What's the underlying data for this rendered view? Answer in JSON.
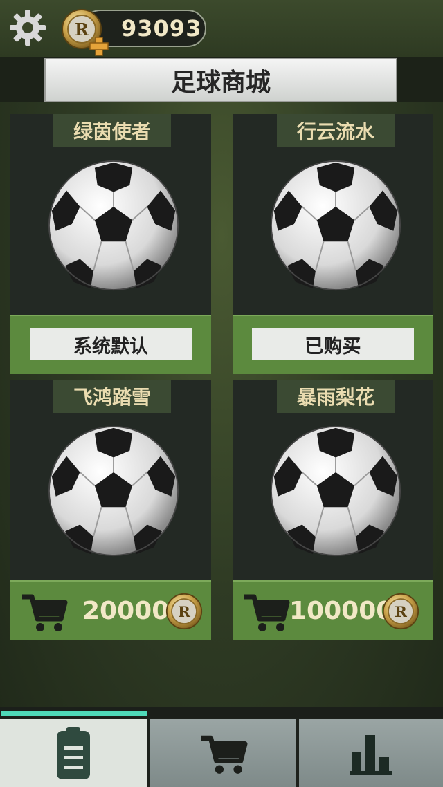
{
  "header": {
    "balance": "93093",
    "currency_symbol": "R"
  },
  "title": "足球商城",
  "cards": [
    {
      "name": "绿茵使者",
      "status": "系统默认"
    },
    {
      "name": "行云流水",
      "status": "已购买"
    },
    {
      "name": "飞鸿踏雪",
      "price": "20000"
    },
    {
      "name": "暴雨梨花",
      "price": "100000"
    }
  ],
  "progress": 0.33,
  "tabs": [
    {
      "icon": "clipboard-icon",
      "active": true
    },
    {
      "icon": "cart-icon",
      "active": false
    },
    {
      "icon": "bar-chart-icon",
      "active": false
    }
  ],
  "colors": {
    "accent_green": "#5c8a3e",
    "progress": "#4fd9b8",
    "gold_text": "#f1e8c6"
  }
}
